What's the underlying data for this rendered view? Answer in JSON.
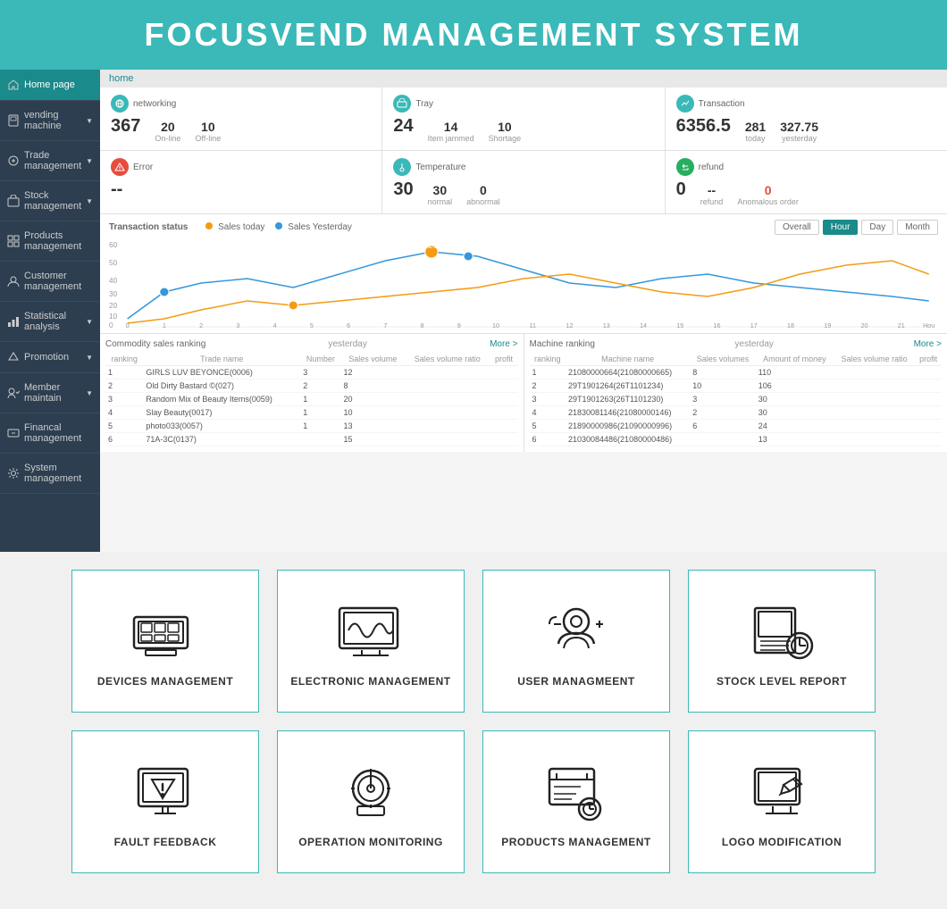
{
  "header": {
    "title": "FOCUSVEND MANAGEMENT SYSTEM"
  },
  "breadcrumb": {
    "home": "home"
  },
  "sidebar": {
    "items": [
      {
        "id": "home-page",
        "label": "Home page",
        "active": true,
        "hasArrow": false
      },
      {
        "id": "vending-machine",
        "label": "vending machine",
        "active": false,
        "hasArrow": true
      },
      {
        "id": "trade-management",
        "label": "Trade management",
        "active": false,
        "hasArrow": true
      },
      {
        "id": "stock-management",
        "label": "Stock management",
        "active": false,
        "hasArrow": true
      },
      {
        "id": "products-management",
        "label": "Products management",
        "active": false,
        "hasArrow": false
      },
      {
        "id": "customer-management",
        "label": "Customer management",
        "active": false,
        "hasArrow": false
      },
      {
        "id": "statistical-analysis",
        "label": "Statistical analysis",
        "active": false,
        "hasArrow": true
      },
      {
        "id": "promotion",
        "label": "Promotion",
        "active": false,
        "hasArrow": true
      },
      {
        "id": "member-maintain",
        "label": "Member maintain",
        "active": false,
        "hasArrow": true
      },
      {
        "id": "financial-management",
        "label": "Financal management",
        "active": false,
        "hasArrow": false
      },
      {
        "id": "system-management",
        "label": "System management",
        "active": false,
        "hasArrow": false
      }
    ]
  },
  "stats": {
    "networking": {
      "label": "networking",
      "total": "367",
      "online_count": "20",
      "online_label": "On-line",
      "offline_count": "10",
      "offline_label": "Off-line"
    },
    "tray": {
      "label": "Tray",
      "total": "24",
      "jammed_count": "14",
      "jammed_label": "Item jammed",
      "shortage_count": "10",
      "shortage_label": "Shortage"
    },
    "transaction": {
      "label": "Transaction",
      "total": "6356.5",
      "today_count": "281",
      "today_label": "today",
      "yesterday_val": "327.75",
      "yesterday_label": "yesterday"
    },
    "error": {
      "label": "Error",
      "value": "--"
    },
    "temperature": {
      "label": "Temperature",
      "total": "30",
      "normal_count": "30",
      "normal_label": "normal",
      "abnormal_count": "0",
      "abnormal_label": "abnormal"
    },
    "refund": {
      "label": "refund",
      "total": "0",
      "refund_val": "--",
      "refund_label": "refund",
      "anomalous_count": "0",
      "anomalous_label": "Anomalous order"
    }
  },
  "chart": {
    "title": "Transaction status",
    "legend_today": "Sales today",
    "legend_yesterday": "Sales Yesterday",
    "tabs": [
      "Overall",
      "Hour",
      "Day",
      "Month"
    ],
    "active_tab": "Hour"
  },
  "commodity_table": {
    "title": "Commodity sales ranking",
    "yesterday_label": "yesterday",
    "more_label": "More >",
    "columns": [
      "ranking",
      "Trade name",
      "Number",
      "Sales volume",
      "Sales volume ratio",
      "profit"
    ],
    "rows": [
      {
        "rank": "1",
        "name": "GIRLS LUV BEYONCE(0006)",
        "number": "3",
        "sales": "12",
        "ratio": "",
        "profit": ""
      },
      {
        "rank": "2",
        "name": "Old Dirty Bastard ©(027)",
        "number": "2",
        "sales": "8",
        "ratio": "",
        "profit": ""
      },
      {
        "rank": "3",
        "name": "Random Mix of Beauty Items(0059)",
        "number": "1",
        "sales": "20",
        "ratio": "",
        "profit": ""
      },
      {
        "rank": "4",
        "name": "Slay Beauty(0017)",
        "number": "1",
        "sales": "10",
        "ratio": "",
        "profit": ""
      },
      {
        "rank": "5",
        "name": "photo033(0057)",
        "number": "1",
        "sales": "13",
        "ratio": "",
        "profit": ""
      },
      {
        "rank": "6",
        "name": "71A-3C(0137)",
        "number": "",
        "sales": "15",
        "ratio": "",
        "profit": ""
      }
    ]
  },
  "machine_table": {
    "title": "Machine ranking",
    "yesterday_label": "yesterday",
    "more_label": "More >",
    "columns": [
      "ranking",
      "Machine name",
      "Sales volumes",
      "Amount of money",
      "Sales volume ratio",
      "profit"
    ],
    "rows": [
      {
        "rank": "1",
        "name": "21080000664(21080000665)",
        "volumes": "8",
        "amount": "110",
        "ratio": "",
        "profit": ""
      },
      {
        "rank": "2",
        "name": "29T1901264(26T1101234)",
        "volumes": "10",
        "amount": "106",
        "ratio": "",
        "profit": ""
      },
      {
        "rank": "3",
        "name": "29T1901263(26T1101230)",
        "volumes": "3",
        "amount": "30",
        "ratio": "",
        "profit": ""
      },
      {
        "rank": "4",
        "name": "21830081146(21080000146)",
        "volumes": "2",
        "amount": "30",
        "ratio": "",
        "profit": ""
      },
      {
        "rank": "5",
        "name": "21890000986(21090000996)",
        "volumes": "6",
        "amount": "24",
        "ratio": "",
        "profit": ""
      },
      {
        "rank": "6",
        "name": "21030084486(21080000486)",
        "volumes": "",
        "amount": "13",
        "ratio": "",
        "profit": ""
      }
    ]
  },
  "cards": {
    "row1": [
      {
        "id": "devices-management",
        "label": "DEVICES MANAGEMENT"
      },
      {
        "id": "electronic-management",
        "label": "ELECTRONIC MANAGEMENT"
      },
      {
        "id": "user-management",
        "label": "USER MANAGMEENT"
      },
      {
        "id": "stock-level-report",
        "label": "STOCK LEVEL REPORT"
      }
    ],
    "row2": [
      {
        "id": "fault-feedback",
        "label": "FAULT FEEDBACK"
      },
      {
        "id": "operation-monitoring",
        "label": "OPERATION MONITORING"
      },
      {
        "id": "products-management",
        "label": "PRODUCTS MANAGEMENT"
      },
      {
        "id": "logo-modification",
        "label": "LOGO MODIFICATION"
      }
    ]
  }
}
